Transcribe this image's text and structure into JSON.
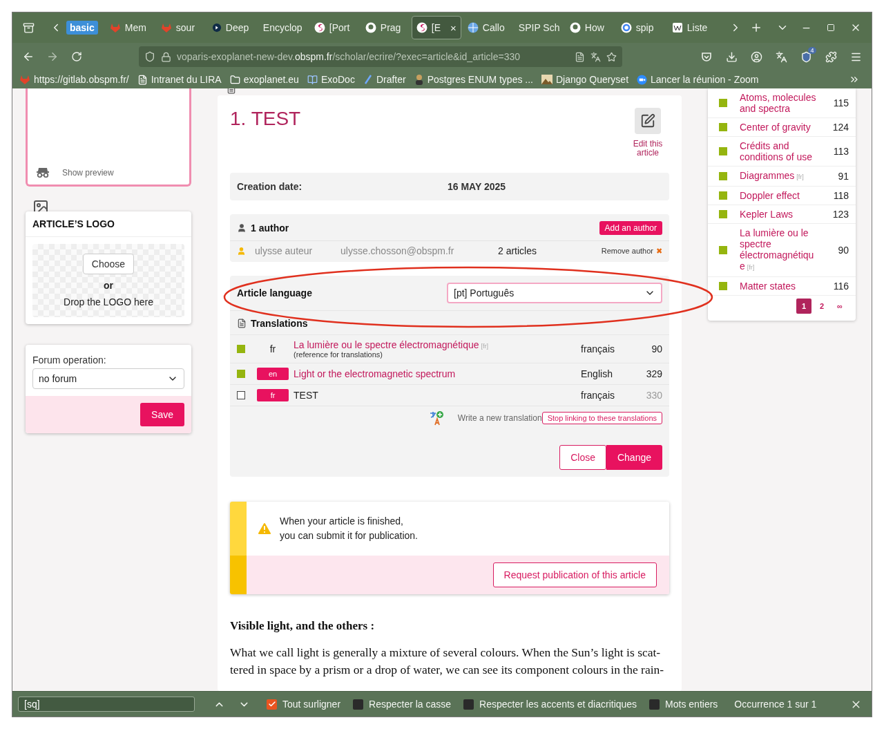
{
  "browser": {
    "tab_group": "basic",
    "tabs": [
      {
        "label": "Mem",
        "selected": false
      },
      {
        "label": "sour",
        "selected": false
      },
      {
        "label": "Deep",
        "selected": false
      },
      {
        "label": "Encyclop",
        "selected": false
      },
      {
        "label": "[Port",
        "selected": false
      },
      {
        "label": "Prag",
        "selected": false
      },
      {
        "label": "[E",
        "selected": true,
        "close": "×"
      },
      {
        "label": "Callo",
        "selected": false
      },
      {
        "label": "SPIP Sch",
        "selected": false
      },
      {
        "label": "How",
        "selected": false
      },
      {
        "label": "spip",
        "selected": false
      },
      {
        "label": "Liste",
        "selected": false
      }
    ],
    "url": {
      "before": "voparis-exoplanet-new-dev.",
      "domain": "obspm.fr",
      "after": "/scholar/ecrire/?exec=article&id_article=330"
    },
    "extension_badge": "4",
    "bookmarks": [
      "https://gitlab.obspm.fr/",
      "Intranet du LIRA",
      "exoplanet.eu",
      "ExoDoc",
      "Drafter",
      "Postgres ENUM types ...",
      "Django Queryset",
      "Lancer la réunion - Zoom"
    ]
  },
  "left": {
    "preview": "Show preview",
    "logo": {
      "title": "ARTICLE’S LOGO",
      "choose": "Choose",
      "or": "or",
      "drop": "Drop the LOGO here"
    },
    "forum": {
      "label": "Forum operation:",
      "value": "no forum",
      "save": "Save"
    }
  },
  "article": {
    "title": "1. TEST",
    "edit": "Edit this article",
    "creation": {
      "label": "Creation date:",
      "value": "16 MAY 2025"
    },
    "authors": {
      "title": "1 author",
      "add": "Add an author",
      "rows": [
        {
          "name": "ulysse auteur",
          "email": "ulysse.chosson@obspm.fr",
          "articles": "2 articles",
          "remove": "Remove author",
          "remove_icon": "✖"
        }
      ]
    },
    "language": {
      "label": "Article language",
      "value": "[pt] Português"
    },
    "translations": {
      "title": "Translations",
      "rows": [
        {
          "kind": "status",
          "color": "#95b50f",
          "lang": "fr",
          "reference": true,
          "title": "La lumière ou le spectre électromagnétique",
          "tag": "[fr]",
          "note": "(reference for translations)",
          "language": "français",
          "count": "90",
          "current": false
        },
        {
          "kind": "status",
          "color": "#95b50f",
          "lang": "en",
          "reference": false,
          "title": "Light or the electromagnetic spectrum",
          "language": "English",
          "count": "329",
          "current": false
        },
        {
          "kind": "checkbox",
          "checked": false,
          "lang": "fr",
          "reference": false,
          "title": "TEST",
          "language": "français",
          "count": "330",
          "current": true
        }
      ],
      "new": "Write a new translation",
      "unlink": "Stop linking to these translations",
      "close": "Close",
      "change": "Change"
    },
    "notice": {
      "lines": [
        "When your article is finished,",
        "you can submit it for publication."
      ],
      "button": "Request publication of this article"
    },
    "heading": "Visible light, and the others :",
    "paragraph": [
      "What we call light is generally a mixture of several colours. When the Sun’s light is scat-",
      "tered in space by a prism or a drop of water, we can see its component colours in the rain-"
    ]
  },
  "right": {
    "items": [
      {
        "title": "Atoms, molecules and spectra",
        "count": "115",
        "color": "#95b50f"
      },
      {
        "title": "Center of gravity",
        "count": "124",
        "color": "#95b50f"
      },
      {
        "title": "Crédits and conditions of use",
        "count": "113",
        "color": "#95b50f"
      },
      {
        "title": "Diagrammes",
        "tag": "[fr]",
        "count": "91",
        "color": "#95b50f"
      },
      {
        "title": "Doppler effect",
        "count": "118",
        "color": "#95b50f"
      },
      {
        "title": "Kepler Laws",
        "count": "123",
        "color": "#95b50f"
      },
      {
        "title": "La lumière ou le spectre électromagnétiqu e",
        "tag": "[fr]",
        "count": "90",
        "color": "#95b50f"
      },
      {
        "title": "Matter states",
        "count": "116",
        "color": "#95b50f"
      }
    ],
    "pages": [
      {
        "label": "1",
        "selected": true
      },
      {
        "label": "2",
        "selected": false
      },
      {
        "label": "∞",
        "selected": false
      }
    ]
  },
  "find_bar": {
    "value": "[sq]",
    "options": [
      {
        "label": "Tout surligner",
        "checked": true
      },
      {
        "label": "Respecter la casse",
        "checked": false
      },
      {
        "label": "Respecter les accents et diacritiques",
        "checked": false
      },
      {
        "label": "Mots entiers",
        "checked": false
      }
    ],
    "status": "Occurrence 1 sur 1"
  }
}
